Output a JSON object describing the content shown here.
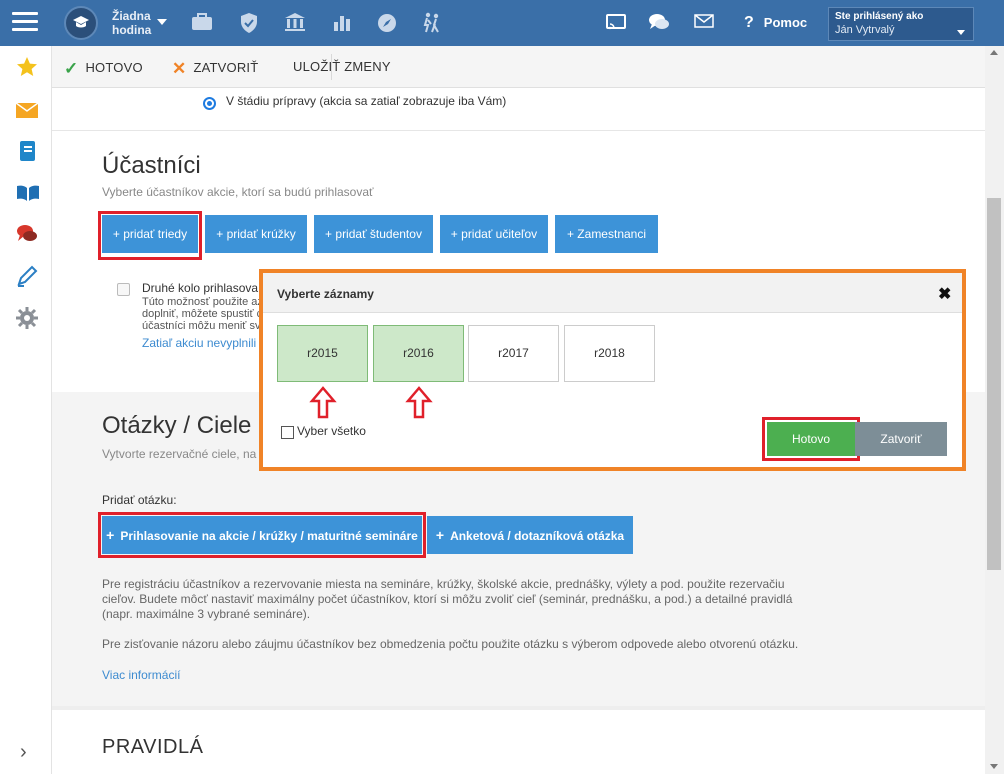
{
  "topbar": {
    "hour_label": "Žiadna hodina",
    "help_label": "Pomoc",
    "user_caption": "Ste prihlásený ako",
    "user_name": "Ján Vytrvalý",
    "nav_icons": [
      "briefcase-icon",
      "shield-check-icon",
      "institution-icon",
      "bar-chart-icon",
      "compass-icon",
      "walking-people-icon",
      "cast-icon",
      "chat-icon",
      "email-icon"
    ]
  },
  "sidebar": {
    "icons": [
      "star-icon",
      "envelope-icon",
      "notebook-icon",
      "open-book-icon",
      "chat-bubbles-icon",
      "pen-icon",
      "gear-icon"
    ],
    "expand_icon": "chevron-right-icon"
  },
  "toolbar": {
    "done_label": "HOTOVO",
    "close_label": "ZATVORIŤ",
    "save_label": "ULOŽIŤ ZMENY"
  },
  "status_section": {
    "radio_label": "V štádiu prípravy (akcia sa zatiaľ zobrazuje iba Vám)"
  },
  "participants": {
    "heading": "Účastníci",
    "subtitle": "Vyberte účastníkov akcie, ktorí sa budú prihlasovať",
    "buttons": [
      "+ pridať triedy",
      "+ pridať krúžky",
      "+ pridať študentov",
      "+ pridať učiteľov",
      "+ Zamestnanci"
    ],
    "second_round_label": "Druhé kolo prihlasova",
    "second_round_help": [
      "Túto možnosť použite az",
      "doplniť, môžete spustiť c",
      "účastníci môžu meniť sv"
    ],
    "incomplete_link": "Zatiaľ akciu nevyplnili"
  },
  "questions": {
    "heading": "Otázky / Ciele",
    "subtitle": "Vytvorte rezervačné ciele, na",
    "add_label": "Pridať otázku:",
    "btn_registration": "Prihlasovanie na akcie / krúžky / maturitné semináre",
    "btn_survey": "Anketová / dotazníková otázka",
    "para1": "Pre registráciu účastníkov a rezervovanie miesta na semináre, krúžky, školské akcie, prednášky, výlety a pod. použite rezervačiu cieľov. Budete môcť nastaviť maximálny počet účastníkov, ktorí si môžu zvoliť cieľ (seminár, prednášku, a pod.) a detailné pravidlá (napr. maximálne 3 vybrané semináre).",
    "para1_lines": [
      "Pre registráciu účastníkov a rezervovanie miesta na semináre, krúžky, školské akcie, prednášky, výlety a pod. použite rezervačiu",
      "cieľov. Budete môcť nastaviť maximálny počet účastníkov, ktorí si môžu zvoliť cieľ (seminár, prednášku, a pod.) a detailné pravidlá",
      "(napr. maximálne 3 vybrané semináre)."
    ],
    "para2": "Pre zisťovanie názoru alebo záujmu účastníkov bez obmedzenia počtu použite otázku s výberom odpovede alebo otvorenú otázku.",
    "more_link": "Viac informácií"
  },
  "rules": {
    "heading": "PRAVIDLÁ"
  },
  "modal": {
    "title": "Vyberte záznamy",
    "close_icon": "close-x-icon",
    "tiles": [
      {
        "label": "r2015",
        "selected": true
      },
      {
        "label": "r2016",
        "selected": true
      },
      {
        "label": "r2017",
        "selected": false
      },
      {
        "label": "r2018",
        "selected": false
      }
    ],
    "select_all_label": "Vyber všetko",
    "done_label": "Hotovo",
    "close_label": "Zatvoriť"
  },
  "colors": {
    "topbar": "#3a6fa8",
    "primary_button": "#3d93d8",
    "highlight": "#e0202a",
    "modal_border": "#f08327",
    "selected_tile": "#cde8c9",
    "green_button": "#4caf50",
    "grey_button": "#7d8e97",
    "arrow": "#e0202a"
  }
}
